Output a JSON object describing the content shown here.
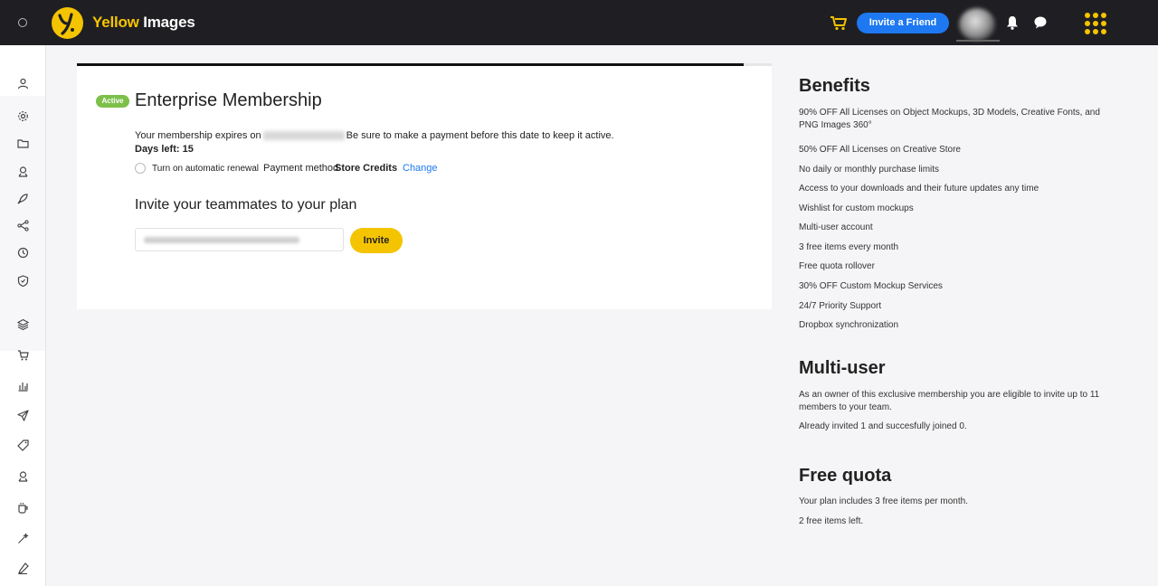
{
  "app": {
    "brand_part1": "Yellow",
    "brand_part2": " Images",
    "accent_color": "#f5c400",
    "topbar_color": "#1f1f23",
    "invite_friend_label": "Invite a Friend",
    "icons": [
      "menu-circle-icon",
      "logo-icon",
      "cart-icon",
      "avatar",
      "bell-icon",
      "chat-icon",
      "apps-grid-icon"
    ]
  },
  "sidebar": {
    "icons": [
      "user-icon",
      "gear-icon",
      "folder-icon",
      "user-badge-icon",
      "rocket-icon",
      "share-icon",
      "clock-icon",
      "shield-icon",
      "layers-icon",
      "cart-icon",
      "bar-chart-icon",
      "send-icon",
      "tag-icon",
      "user-badge-icon",
      "cup-icon",
      "magic-wand-icon",
      "pen-icon"
    ]
  },
  "membership": {
    "progress": 0.96,
    "status": "Active",
    "status_color": "#7cc04a",
    "title": "Enterprise Membership",
    "expires_prefix": "Your membership expires on",
    "expires_suffix": "Be sure to make a payment before this date to keep it active.",
    "days_left": "Days left: 15",
    "renewal_label": "Turn on automatic renewal",
    "payment_label": "Payment method",
    "payment_value": "Store Credits",
    "change_label": "Change"
  },
  "invite": {
    "title": "Invite your teammates to your plan",
    "button_label": "Invite"
  },
  "benefits": {
    "title": "Benefits",
    "items": [
      "90% OFF All Licenses on Object Mockups, 3D Models, Creative Fonts, and PNG Images 360°",
      "50% OFF All Licenses on Creative Store",
      "No daily or monthly purchase limits",
      "Access to your downloads and their future updates any time",
      "Wishlist for custom mockups",
      "Multi-user account",
      "3 free items every month",
      "Free quota rollover",
      "30% OFF Custom Mockup Services",
      "24/7 Priority Support",
      "Dropbox synchronization"
    ]
  },
  "multiuser": {
    "title": "Multi-user",
    "text1": "As an owner of this exclusive membership you are eligible to invite up to 11 members to your team.",
    "text2": "Already invited 1 and succesfully joined 0."
  },
  "quota": {
    "title": "Free quota",
    "text1": "Your plan includes 3 free items per month.",
    "text2": "2 free items left."
  }
}
